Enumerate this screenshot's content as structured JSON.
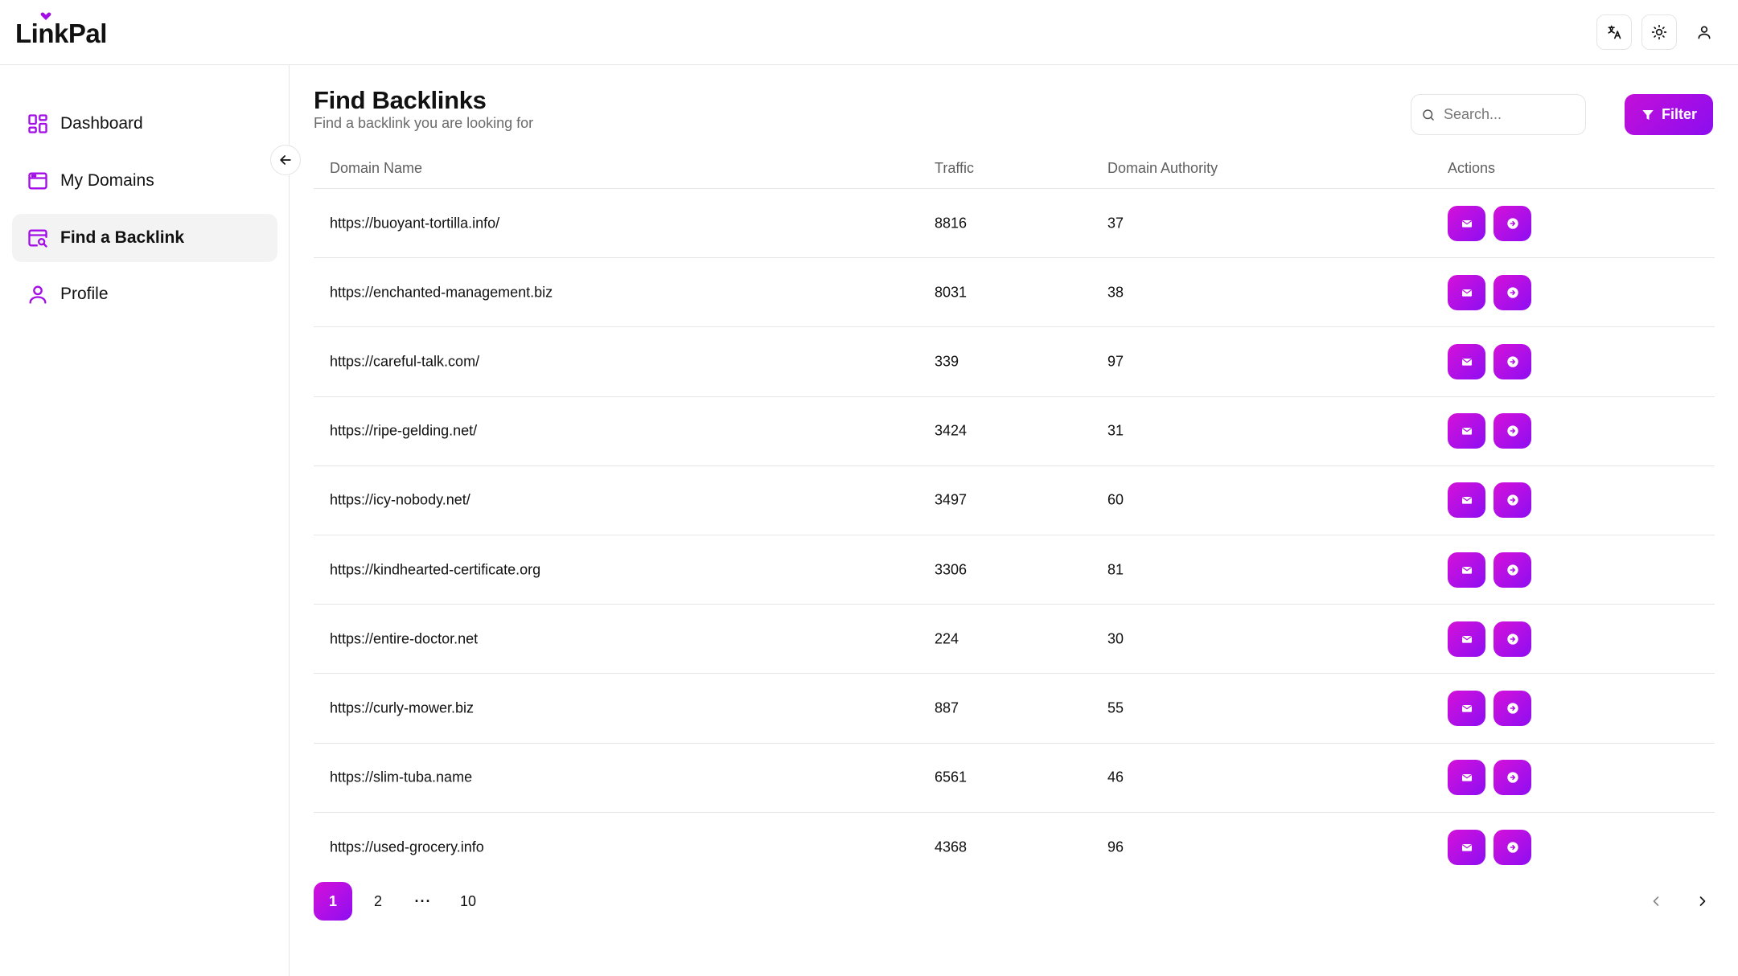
{
  "app": {
    "logo_text_pre": "Li",
    "logo_text_i": "n",
    "logo_text_post": "kPal",
    "brand_color": "#a30de6"
  },
  "header": {
    "actions": [
      {
        "icon": "translate-icon"
      },
      {
        "icon": "sun-icon"
      },
      {
        "icon": "user-icon"
      }
    ]
  },
  "sidebar": {
    "items": [
      {
        "label": "Dashboard",
        "icon": "dashboard-icon",
        "active": false
      },
      {
        "label": "My Domains",
        "icon": "browser-window-icon",
        "active": false
      },
      {
        "label": "Find a Backlink",
        "icon": "window-search-icon",
        "active": true
      },
      {
        "label": "Profile",
        "icon": "user-icon",
        "active": false
      }
    ],
    "collapse_icon": "arrow-left-icon"
  },
  "main": {
    "title": "Find Backlinks",
    "subtitle": "Find a backlink you are looking for",
    "search": {
      "placeholder": "Search..."
    },
    "filter_label": "Filter"
  },
  "table": {
    "columns": [
      "Domain Name",
      "Traffic",
      "Domain Authority",
      "Actions"
    ],
    "rows": [
      {
        "domain": "https://buoyant-tortilla.info/",
        "traffic": "8816",
        "da": "37"
      },
      {
        "domain": "https://enchanted-management.biz",
        "traffic": "8031",
        "da": "38"
      },
      {
        "domain": "https://careful-talk.com/",
        "traffic": "339",
        "da": "97"
      },
      {
        "domain": "https://ripe-gelding.net/",
        "traffic": "3424",
        "da": "31"
      },
      {
        "domain": "https://icy-nobody.net/",
        "traffic": "3497",
        "da": "60"
      },
      {
        "domain": "https://kindhearted-certificate.org",
        "traffic": "3306",
        "da": "81"
      },
      {
        "domain": "https://entire-doctor.net",
        "traffic": "224",
        "da": "30"
      },
      {
        "domain": "https://curly-mower.biz",
        "traffic": "887",
        "da": "55"
      },
      {
        "domain": "https://slim-tuba.name",
        "traffic": "6561",
        "da": "46"
      },
      {
        "domain": "https://used-grocery.info",
        "traffic": "4368",
        "da": "96"
      }
    ]
  },
  "pagination": {
    "pages": [
      "1",
      "2",
      "···",
      "10"
    ],
    "current": "1"
  }
}
